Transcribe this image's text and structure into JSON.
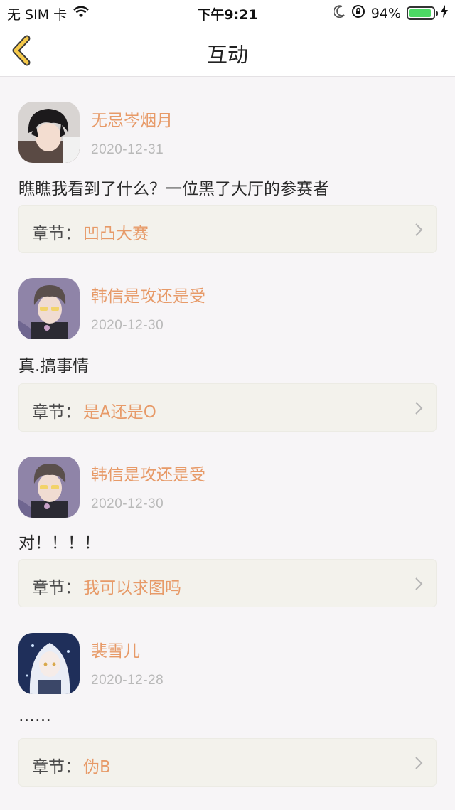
{
  "status_bar": {
    "carrier": "无 SIM 卡",
    "time": "下午9:21",
    "battery_percent": "94%",
    "battery_level": 0.94
  },
  "nav": {
    "title": "互动",
    "back_icon": "back-chevron-icon"
  },
  "comments": [
    {
      "username": "无忌岑烟月",
      "date": "2020-12-31",
      "text": "瞧瞧我看到了什么？一位黑了大厅的参赛者",
      "chapter_label": "章节：",
      "chapter": "凹凸大赛",
      "avatar": "avatar-dark-hair"
    },
    {
      "username": "韩信是攻还是受",
      "date": "2020-12-30",
      "text": "真.搞事情",
      "chapter_label": "章节：",
      "chapter": "是A还是O",
      "avatar": "avatar-glasses"
    },
    {
      "username": "韩信是攻还是受",
      "date": "2020-12-30",
      "text": "对！！！！",
      "chapter_label": "章节：",
      "chapter": "我可以求图吗",
      "avatar": "avatar-glasses"
    },
    {
      "username": "裴雪儿",
      "date": "2020-12-28",
      "text": "……",
      "chapter_label": "章节：",
      "chapter": "伪B",
      "avatar": "avatar-white-hair"
    }
  ],
  "colors": {
    "accent": "#e79a68",
    "back_icon": "#f5c94a",
    "chapter_bg": "#f3f2ec",
    "page_bg": "#f7f5f7"
  }
}
